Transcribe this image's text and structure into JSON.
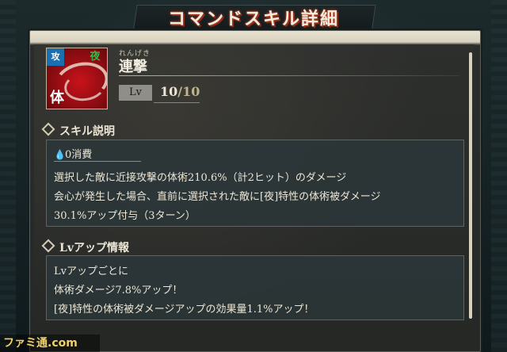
{
  "header": {
    "title": "コマンドスキル詳細"
  },
  "skill": {
    "ruby": "れんげき",
    "name": "連撃",
    "icon_badges": {
      "attack": "攻",
      "night": "夜",
      "body": "体"
    },
    "level_label": "Lv",
    "level_current": "10",
    "level_max": "/10"
  },
  "skill_description": {
    "heading": "スキル説明",
    "cost": "0消費",
    "lines": [
      "選択した敵に近接攻撃の体術210.6%（計2ヒット）のダメージ",
      "会心が発生した場合、直前に選択された敵に[夜]特性の体術被ダメージ",
      "30.1%アップ付与（3ターン）"
    ]
  },
  "level_up_info": {
    "heading": "Lvアップ情報",
    "lines": [
      "Lvアップごとに",
      "体術ダメージ7.8%アップ！",
      "[夜]特性の体術被ダメージアップの効果量1.1%アップ！"
    ]
  },
  "watermark": "ファミ通.com",
  "colors": {
    "accent_red": "#c9131a",
    "title_glow": "#d9562f",
    "attack_badge": "#1a6fb0",
    "night_badge": "#3fb34a"
  },
  "icons": {
    "cost": "droplet-icon",
    "section": "diamond-icon"
  }
}
